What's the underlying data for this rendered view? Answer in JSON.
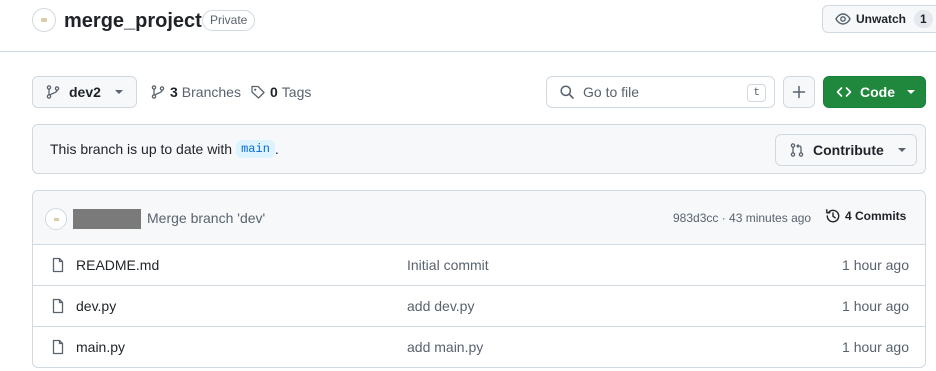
{
  "repo": {
    "name": "merge_project",
    "visibility": "Private",
    "watch_label": "Unwatch",
    "watch_count": "1"
  },
  "toolbar": {
    "branch_name": "dev2",
    "branches_count": "3",
    "branches_label": "Branches",
    "tags_count": "0",
    "tags_label": "Tags",
    "search_placeholder": "Go to file",
    "search_shortcut": "t",
    "code_label": "Code"
  },
  "status": {
    "text": "This branch is up to date with",
    "base_branch": "main",
    "period": ".",
    "contribute_label": "Contribute"
  },
  "latest_commit": {
    "message": "Merge branch 'dev'",
    "meta": "983d3cc · 43 minutes ago",
    "commits_label": "4 Commits"
  },
  "files": [
    {
      "name": "README.md",
      "message": "Initial commit",
      "time": "1 hour ago"
    },
    {
      "name": "dev.py",
      "message": "add dev.py",
      "time": "1 hour ago"
    },
    {
      "name": "main.py",
      "message": "add main.py",
      "time": "1 hour ago"
    }
  ],
  "colors": {
    "accent_green": "#1f883d",
    "link_blue": "#0969da",
    "border": "#d1d9e0",
    "muted_bg": "#f6f8fa"
  }
}
